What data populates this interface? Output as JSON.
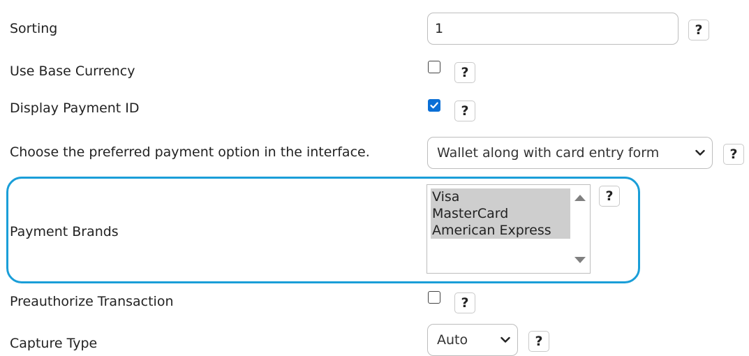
{
  "form": {
    "sorting": {
      "label": "Sorting",
      "value": "1",
      "help": "?"
    },
    "use_base_currency": {
      "label": "Use Base Currency",
      "checked": false,
      "help": "?"
    },
    "display_payment_id": {
      "label": "Display Payment ID",
      "checked": true,
      "help": "?"
    },
    "payment_option": {
      "label": "Choose the preferred payment option in the interface.",
      "selected": "Wallet along with card entry form",
      "help": "?"
    },
    "payment_brands": {
      "label": "Payment Brands",
      "options": [
        "Visa",
        "MasterCard",
        "American Express"
      ],
      "selected": [
        "Visa",
        "MasterCard",
        "American Express"
      ],
      "help": "?"
    },
    "preauthorize_transaction": {
      "label": "Preauthorize Transaction",
      "checked": false,
      "help": "?"
    },
    "capture_type": {
      "label": "Capture Type",
      "selected": "Auto",
      "help": "?"
    }
  },
  "colors": {
    "highlight_border": "#1a9ed8",
    "checkbox_checked": "#0a6fd6",
    "selected_option_bg": "#cecece"
  },
  "icons": {
    "help": "question-mark-icon",
    "dropdown": "chevron-down-icon",
    "checkmark": "checkmark-icon",
    "scroll_up": "scroll-up-arrow-icon",
    "scroll_down": "scroll-down-arrow-icon"
  }
}
